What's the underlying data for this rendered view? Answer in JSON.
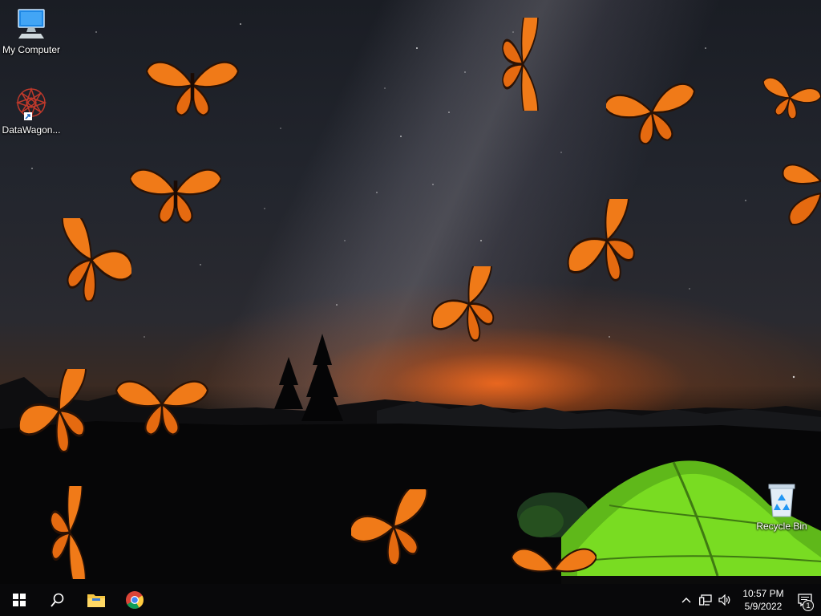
{
  "desktop": {
    "icons": [
      {
        "label": "My Computer",
        "icon": "computer-icon"
      },
      {
        "label": "DataWagon...",
        "icon": "datawagon-shortcut-icon"
      },
      {
        "label": "Recycle Bin",
        "icon": "recycle-bin-icon"
      }
    ],
    "wallpaper": "starry-night-with-butterflies-and-green-tent"
  },
  "taskbar": {
    "start": {
      "icon": "windows-start-icon"
    },
    "search": {
      "icon": "search-icon"
    },
    "pinned": [
      {
        "icon": "file-explorer-icon"
      },
      {
        "icon": "chrome-icon"
      }
    ],
    "tray": {
      "icons": [
        "chevron-up-icon",
        "network-icon",
        "volume-icon"
      ],
      "time": "10:57 PM",
      "date": "5/9/2022",
      "notification_count": "1"
    }
  },
  "colors": {
    "taskbar": "#08080a",
    "butterfly": "#f07a18",
    "tent": "#6fd21c"
  }
}
